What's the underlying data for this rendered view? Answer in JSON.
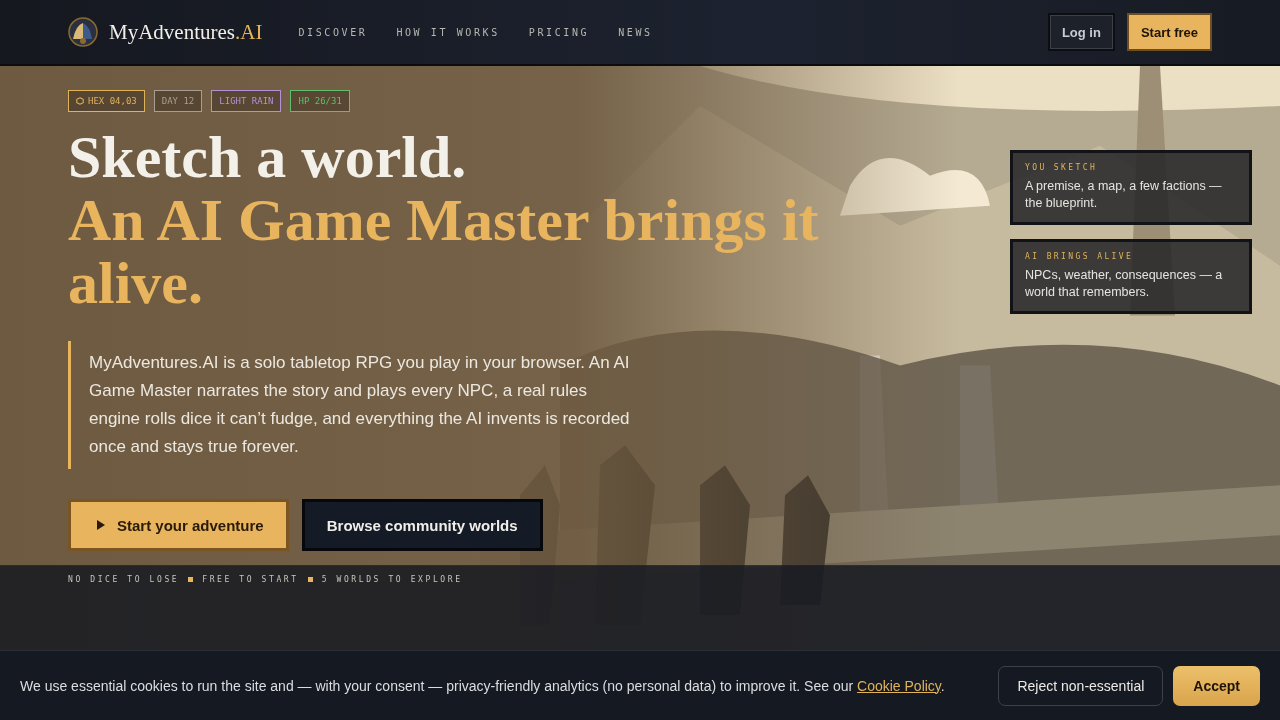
{
  "header": {
    "brand": "MyAdventures",
    "brand_suffix": ".AI",
    "nav": [
      "DISCOVER",
      "HOW IT WORKS",
      "PRICING",
      "NEWS"
    ],
    "login": "Log in",
    "start": "Start free"
  },
  "hero": {
    "kind": "picture",
    "tags": [
      {
        "label": "HEX 04,03",
        "color": "#e0b25a"
      },
      {
        "label": "DAY 12",
        "color": "#a89f92"
      },
      {
        "label": "LIGHT RAIN",
        "color": "#b68fd6"
      },
      {
        "label": "HP 26/31",
        "color": "#5fbf6a"
      }
    ],
    "title_line": "Sketch a world.",
    "title_accent": "An AI Game Master brings it alive.",
    "intro": "MyAdventures.AI is a solo tabletop RPG you play in your browser. An AI Game Master narrates the story and plays every NPC, a real rules engine rolls dice it can’t fudge, and everything the AI invents is recorded once and stays true forever.",
    "primary_button": "Start your adventure",
    "secondary_button": "Browse community worlds",
    "perks": [
      "NO DICE TO LOSE",
      "FREE TO START",
      "5 WORLDS TO EXPLORE"
    ],
    "cards": [
      {
        "label": "YOU SKETCH",
        "text": "A premise, a map, a few factions — the blueprint."
      },
      {
        "label": "AI BRINGS ALIVE",
        "text": "NPCs, weather, consequences — a world that remembers."
      }
    ]
  },
  "cookie_banner": {
    "text": "We use essential cookies to run the site and — with your consent — privacy-friendly analytics (no personal data) to improve it. See our",
    "link": "Cookie Policy",
    "after": ".",
    "reject": "Reject non-essential",
    "accept": "Accept"
  }
}
